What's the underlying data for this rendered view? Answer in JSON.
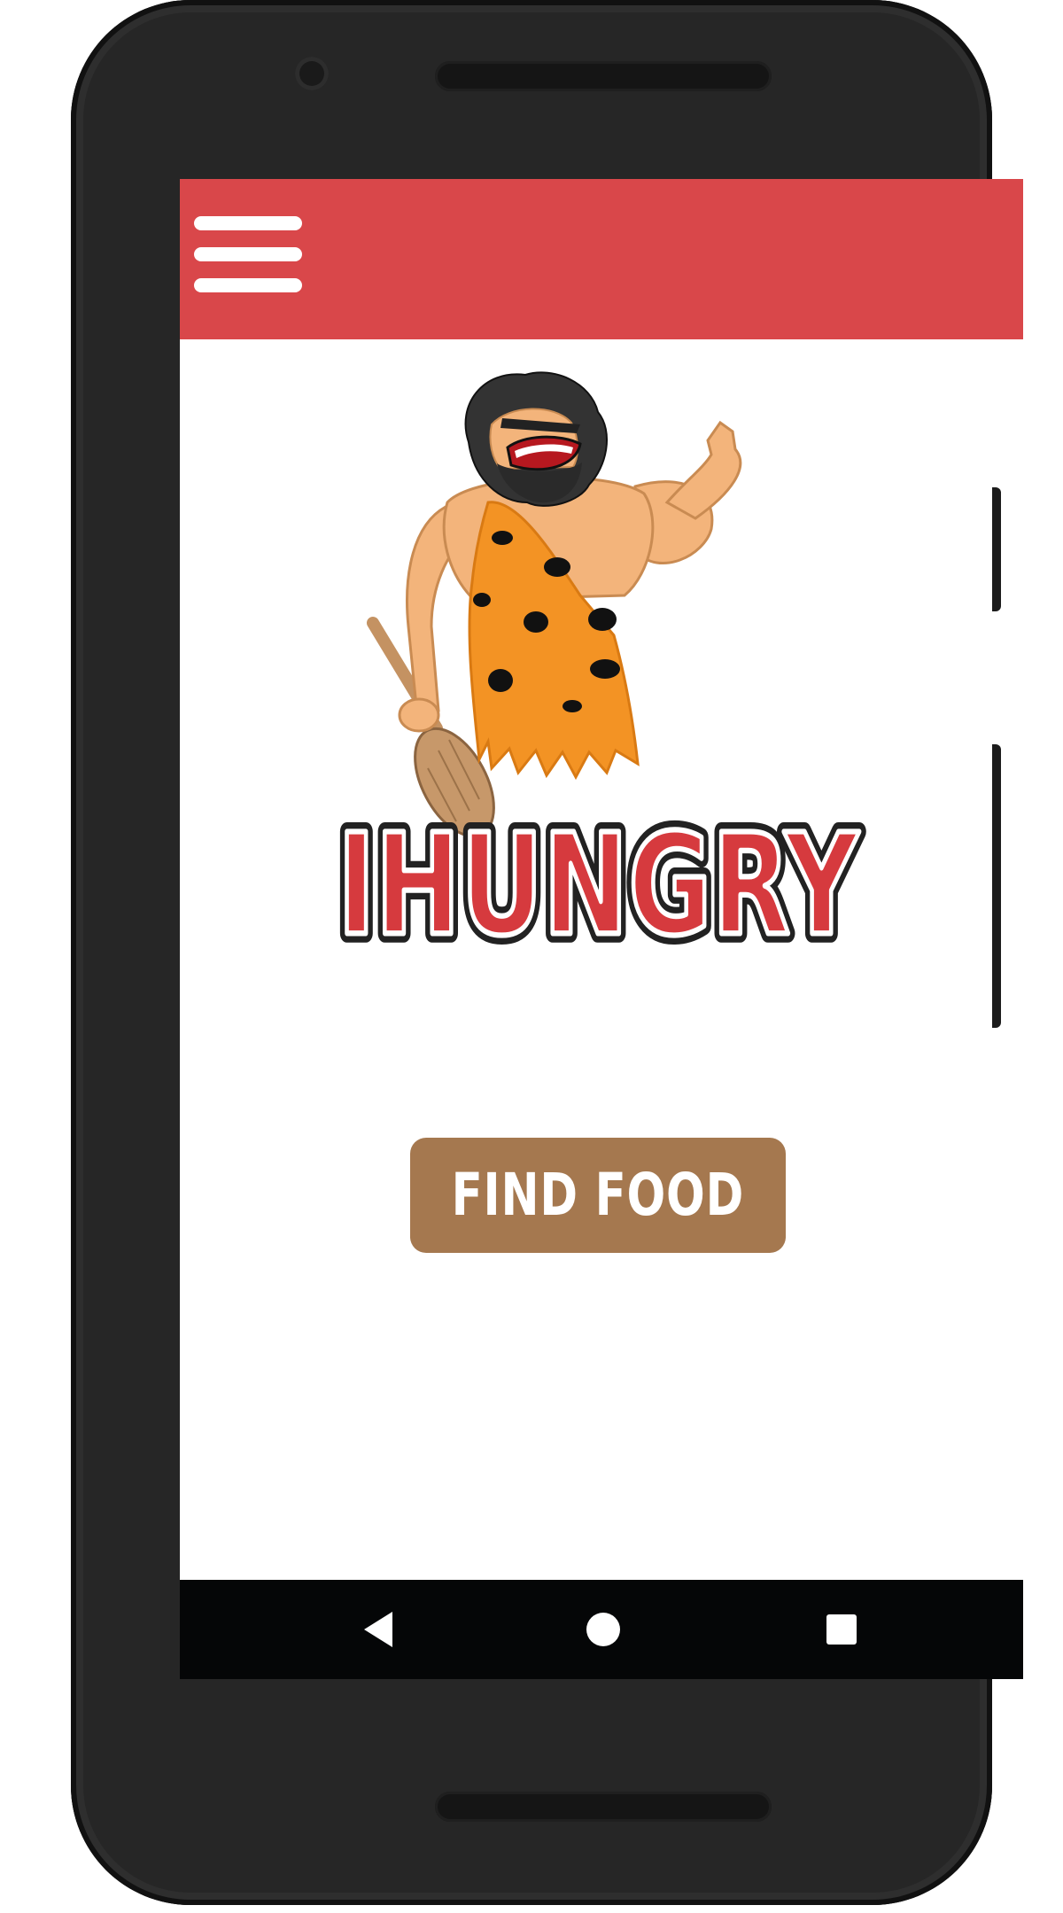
{
  "app": {
    "logo_text": "IHUNGRY",
    "primary_action_label": "FIND FOOD"
  },
  "icons": {
    "menu": "hamburger-menu-icon",
    "back": "back-triangle-icon",
    "home": "home-circle-icon",
    "recents": "recents-square-icon"
  },
  "colors": {
    "app_bar": "#d9474a",
    "button": "#a5784f",
    "logo_red": "#d63a3e",
    "nav_bar": "#050607"
  }
}
